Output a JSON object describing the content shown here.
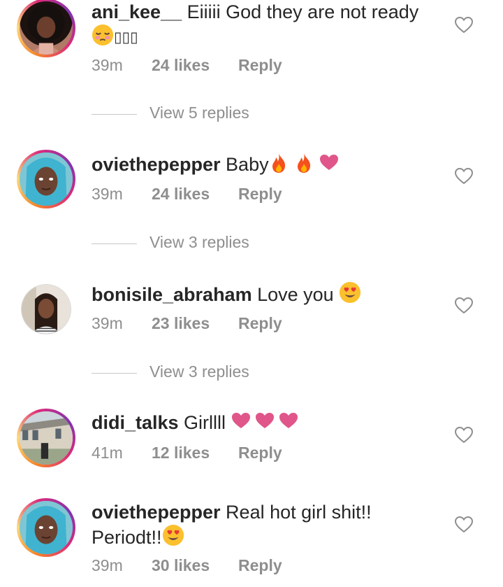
{
  "comments": [
    {
      "username": "ani_kee__",
      "text": " Eiiiii God they are not ready",
      "glyphs": "▯▯▯",
      "time": "39m",
      "likes": "24 likes",
      "reply": "Reply",
      "view_replies": "View 5 replies"
    },
    {
      "username": "oviethepepper",
      "text": " Baby",
      "time": "39m",
      "likes": "24 likes",
      "reply": "Reply",
      "view_replies": "View 3 replies"
    },
    {
      "username": "bonisile_abraham",
      "text": " Love you ",
      "time": "39m",
      "likes": "23 likes",
      "reply": "Reply",
      "view_replies": "View 3 replies"
    },
    {
      "username": "didi_talks",
      "text": " Girllll ",
      "time": "41m",
      "likes": "12 likes",
      "reply": "Reply"
    },
    {
      "username": "oviethepepper",
      "text": " Real hot girl shit!! Periodt!!",
      "time": "39m",
      "likes": "30 likes",
      "reply": "Reply"
    }
  ],
  "icons": {
    "heart_outline": "heart-outline-icon",
    "fire": "fire-emoji",
    "pink_heart": "heart-emoji",
    "heart_eyes": "heart-eyes-emoji",
    "pleading": "pleading-face-emoji"
  },
  "colors": {
    "meta_gray": "#8e8e8e",
    "text": "#262626",
    "emoji_heart": "#e0568a"
  }
}
